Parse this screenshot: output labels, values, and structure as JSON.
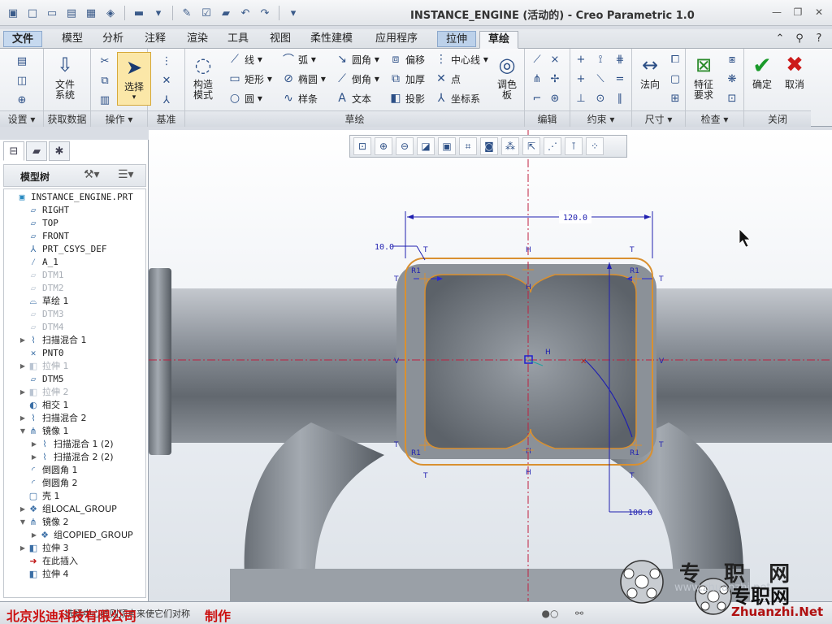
{
  "window": {
    "title": "INSTANCE_ENGINE (活动的) - Creo Parametric 1.0"
  },
  "tabs": {
    "file": "文件",
    "items": [
      "模型",
      "分析",
      "注释",
      "渲染",
      "工具",
      "视图",
      "柔性建模",
      "应用程序"
    ],
    "extrude": "拉伸",
    "sketch": "草绘"
  },
  "ribbon": {
    "groups": {
      "setup": "设置",
      "get_data": "获取数据",
      "operations": "操作",
      "datum": "基准",
      "sketching": "草绘",
      "editing": "编辑",
      "constrain": "约束",
      "dimension": "尺寸",
      "inspect": "检查",
      "close": "关闭"
    },
    "buttons": {
      "file_system": "文件\n系统",
      "select": "选择",
      "construction_mode": "构造\n模式",
      "line": "线",
      "arc": "弧",
      "fillet": "圆角",
      "offset": "偏移",
      "centerline": "中心线",
      "rectangle": "矩形",
      "ellipse": "椭圆",
      "chamfer": "倒角",
      "thicken": "加厚",
      "point": "点",
      "circle": "圆",
      "spline": "样条",
      "text": "文本",
      "project": "投影",
      "coordinate_system": "坐标系",
      "palette": "调色\n板",
      "normal": "法向",
      "feature_requirements": "特征\n要求",
      "ok": "确定",
      "cancel": "取消"
    }
  },
  "model_tree": {
    "header": "模型树",
    "nodes": [
      {
        "label": "INSTANCE_ENGINE.PRT",
        "level": 0,
        "icon": "part-icon",
        "dim": false,
        "cn": false,
        "toggle": ""
      },
      {
        "label": "RIGHT",
        "level": 1,
        "icon": "datum-plane-icon",
        "dim": false,
        "cn": false,
        "toggle": ""
      },
      {
        "label": "TOP",
        "level": 1,
        "icon": "datum-plane-icon",
        "dim": false,
        "cn": false,
        "toggle": ""
      },
      {
        "label": "FRONT",
        "level": 1,
        "icon": "datum-plane-icon",
        "dim": false,
        "cn": false,
        "toggle": ""
      },
      {
        "label": "PRT_CSYS_DEF",
        "level": 1,
        "icon": "csys-icon",
        "dim": false,
        "cn": false,
        "toggle": ""
      },
      {
        "label": "A_1",
        "level": 1,
        "icon": "axis-icon",
        "dim": false,
        "cn": false,
        "toggle": ""
      },
      {
        "label": "DTM1",
        "level": 1,
        "icon": "datum-plane-icon",
        "dim": true,
        "cn": false,
        "toggle": ""
      },
      {
        "label": "DTM2",
        "level": 1,
        "icon": "datum-plane-icon",
        "dim": true,
        "cn": false,
        "toggle": ""
      },
      {
        "label": "草绘 1",
        "level": 1,
        "icon": "sketch-icon",
        "dim": false,
        "cn": true,
        "toggle": ""
      },
      {
        "label": "DTM3",
        "level": 1,
        "icon": "datum-plane-icon",
        "dim": true,
        "cn": false,
        "toggle": ""
      },
      {
        "label": "DTM4",
        "level": 1,
        "icon": "datum-plane-icon",
        "dim": true,
        "cn": false,
        "toggle": ""
      },
      {
        "label": "扫描混合 1",
        "level": 1,
        "icon": "swept-blend-icon",
        "dim": false,
        "cn": true,
        "toggle": "▶"
      },
      {
        "label": "PNT0",
        "level": 1,
        "icon": "datum-point-icon",
        "dim": false,
        "cn": false,
        "toggle": ""
      },
      {
        "label": "拉伸 1",
        "level": 1,
        "icon": "extrude-icon",
        "dim": true,
        "cn": true,
        "toggle": "▶"
      },
      {
        "label": "DTM5",
        "level": 1,
        "icon": "datum-plane-icon",
        "dim": false,
        "cn": false,
        "toggle": ""
      },
      {
        "label": "拉伸 2",
        "level": 1,
        "icon": "extrude-icon",
        "dim": true,
        "cn": true,
        "toggle": "▶"
      },
      {
        "label": "相交 1",
        "level": 1,
        "icon": "intersect-icon",
        "dim": false,
        "cn": true,
        "toggle": ""
      },
      {
        "label": "扫描混合 2",
        "level": 1,
        "icon": "swept-blend-icon",
        "dim": false,
        "cn": true,
        "toggle": "▶"
      },
      {
        "label": "镜像 1",
        "level": 1,
        "icon": "mirror-icon",
        "dim": false,
        "cn": true,
        "toggle": "▼"
      },
      {
        "label": "扫描混合 1 (2)",
        "level": 2,
        "icon": "swept-blend-icon",
        "dim": false,
        "cn": true,
        "toggle": "▶"
      },
      {
        "label": "扫描混合 2 (2)",
        "level": 2,
        "icon": "swept-blend-icon",
        "dim": false,
        "cn": true,
        "toggle": "▶"
      },
      {
        "label": "倒圆角 1",
        "level": 1,
        "icon": "round-icon",
        "dim": false,
        "cn": true,
        "toggle": ""
      },
      {
        "label": "倒圆角 2",
        "level": 1,
        "icon": "round-icon",
        "dim": false,
        "cn": true,
        "toggle": ""
      },
      {
        "label": "壳 1",
        "level": 1,
        "icon": "shell-icon",
        "dim": false,
        "cn": true,
        "toggle": ""
      },
      {
        "label": "组LOCAL_GROUP",
        "level": 1,
        "icon": "group-icon",
        "dim": false,
        "cn": true,
        "toggle": "▶"
      },
      {
        "label": "镜像 2",
        "level": 1,
        "icon": "mirror-icon",
        "dim": false,
        "cn": true,
        "toggle": "▼"
      },
      {
        "label": "组COPIED_GROUP",
        "level": 2,
        "icon": "group-icon",
        "dim": false,
        "cn": true,
        "toggle": "▶"
      },
      {
        "label": "拉伸 3",
        "level": 1,
        "icon": "extrude-icon",
        "dim": false,
        "cn": true,
        "toggle": "▶"
      },
      {
        "label": "在此插入",
        "level": 1,
        "icon": "insert-here-icon",
        "dim": false,
        "cn": true,
        "toggle": ""
      },
      {
        "label": "拉伸 4",
        "level": 1,
        "icon": "extrude-icon",
        "dim": false,
        "cn": true,
        "toggle": ""
      }
    ]
  },
  "sketch": {
    "dims": {
      "width": "120.0",
      "offset": "10.0",
      "height": "100.0"
    },
    "markers": {
      "tangent": "T",
      "horizontal": "H",
      "vertical": "V",
      "radius": "R1"
    }
  },
  "status": {
    "message": "选择中心线则顶点来使它们对称",
    "company": "北京兆迪科技有限公司",
    "made_by": "制作"
  },
  "watermark": {
    "top": "专 职 网",
    "middle": "专职网",
    "url": "Zhuanzhi.Net",
    "faint": "www.zhuanzhi.net"
  },
  "colors": {
    "sketch_orange": "#d99030",
    "dim_blue": "#2020b0",
    "active_ext": "#bcd1ea",
    "accent_red": "#cc1010"
  }
}
